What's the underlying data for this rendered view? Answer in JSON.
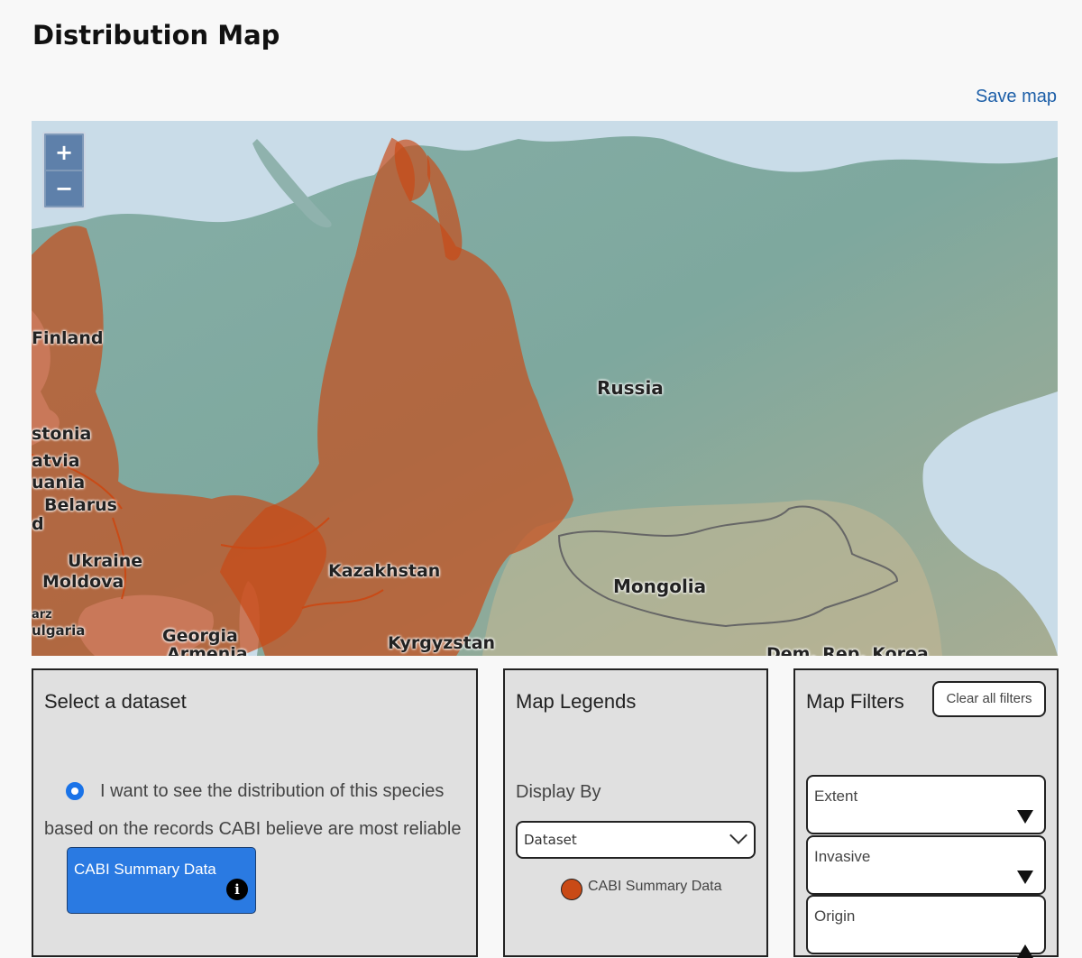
{
  "page": {
    "title": "Distribution Map",
    "save_map": "Save map"
  },
  "map": {
    "zoom_in": "+",
    "zoom_out": "−",
    "highlight_color": "#c94a16",
    "labels": [
      "Finland",
      "Estonia",
      "Latvia",
      "Lithuania",
      "Belarus",
      "Ukraine",
      "Moldova",
      "Bulgaria",
      "Georgia",
      "Armenia",
      "Kazakhstan",
      "Kyrgyzstan",
      "Russia",
      "Mongolia",
      "Dem. Rep. Korea"
    ],
    "labels_shown": [
      "Finland",
      "stonia",
      "atvia",
      "uania",
      "Belarus",
      "d",
      "Ukraine",
      "Moldova",
      "arz",
      "ulgaria",
      "Georgia",
      "Armenia",
      "Kazakhstan",
      "Kyrgyzstan",
      "Russia",
      "Mongolia",
      "Dem. Rep. Korea"
    ]
  },
  "dataset_panel": {
    "title": "Select a dataset",
    "radio_line1": "I want to see the distribution of this species",
    "radio_line2": "based on the records CABI believe are most reliable",
    "button_label": "CABI Summary Data",
    "info_glyph": "i"
  },
  "legend_panel": {
    "title": "Map Legends",
    "display_by": "Display By",
    "select_value": "Dataset",
    "legend_item": "CABI Summary Data",
    "legend_color": "#c94a16"
  },
  "filters_panel": {
    "title": "Map Filters",
    "clear_button": "Clear all filters",
    "filters": [
      "Extent",
      "Invasive",
      "Origin"
    ]
  }
}
